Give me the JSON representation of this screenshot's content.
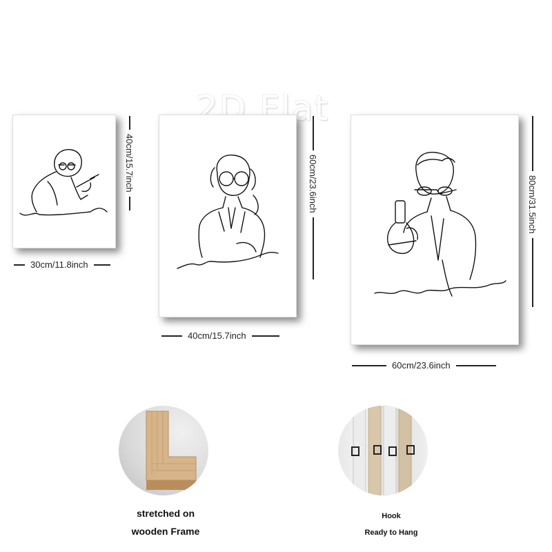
{
  "watermark": "2D Flat",
  "canvases": [
    {
      "width": "30cm/11.8inch",
      "height": "40cm/15.7inch"
    },
    {
      "width": "40cm/15.7inch",
      "height": "60cm/23.6inch"
    },
    {
      "width": "60cm/23.6inch",
      "height": "80cm/31.5inch"
    }
  ],
  "features": {
    "frame": {
      "line1": "stretched on",
      "line2": "wooden Frame"
    },
    "hook": {
      "line1": "Hook",
      "line2": "Ready to Hang"
    }
  },
  "colors": {
    "background": "#ffffff",
    "line_art": "#111111",
    "wood": "#d8b48c"
  }
}
